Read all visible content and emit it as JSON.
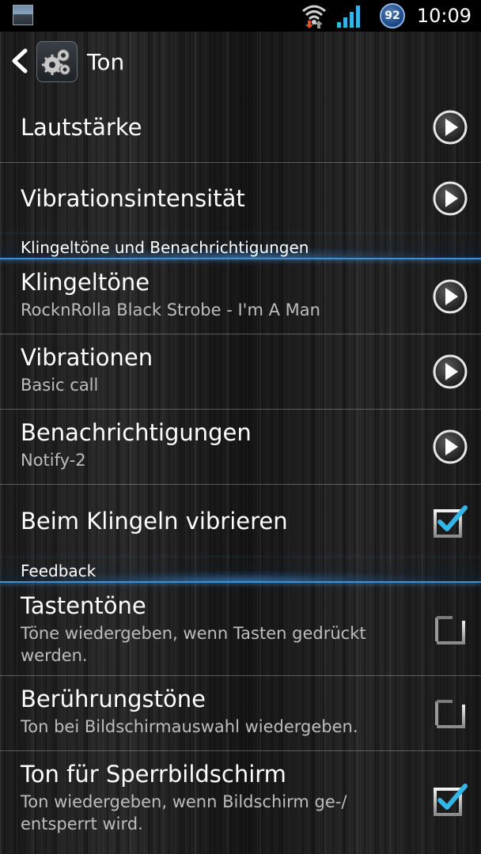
{
  "status_bar": {
    "battery_level": "92",
    "time": "10:09"
  },
  "action_bar": {
    "title": "Ton"
  },
  "colors": {
    "accent": "#3f8fd6",
    "check": "#33b5e5",
    "summary_text": "#bdbdbd"
  },
  "list": {
    "lautstaerke": {
      "title": "Lautstärke",
      "widget": "arrow-right-circle-icon"
    },
    "vibrationsintensitaet": {
      "title": "Vibrationsintensität",
      "widget": "arrow-right-circle-icon"
    },
    "category_ringtones": {
      "label": "Klingeltöne und Benachrichtigungen"
    },
    "klingeltoene": {
      "title": "Klingeltöne",
      "summary": "RocknRolla  Black Strobe  - I'm A Man",
      "widget": "arrow-right-circle-icon"
    },
    "vibrationen": {
      "title": "Vibrationen",
      "summary": "Basic call",
      "widget": "arrow-right-circle-icon"
    },
    "benachrichtigungen": {
      "title": "Benachrichtigungen",
      "summary": "Notify-2",
      "widget": "arrow-right-circle-icon"
    },
    "beim_klingeln": {
      "title": "Beim Klingeln vibrieren",
      "checked": true
    },
    "category_feedback": {
      "label": "Feedback"
    },
    "tastentoene": {
      "title": "Tastentöne",
      "summary": "Töne wiedergeben, wenn Tasten gedrückt werden.",
      "checked": false
    },
    "beruehrungstoene": {
      "title": "Berührungstöne",
      "summary": "Ton bei Bildschirmauswahl wiedergeben.",
      "checked": false
    },
    "sperrbildschirm": {
      "title": "Ton für Sperrbildschirm",
      "summary": "Ton wiedergeben, wenn Bildschirm ge-/ entsperrt wird.",
      "checked": true
    }
  }
}
